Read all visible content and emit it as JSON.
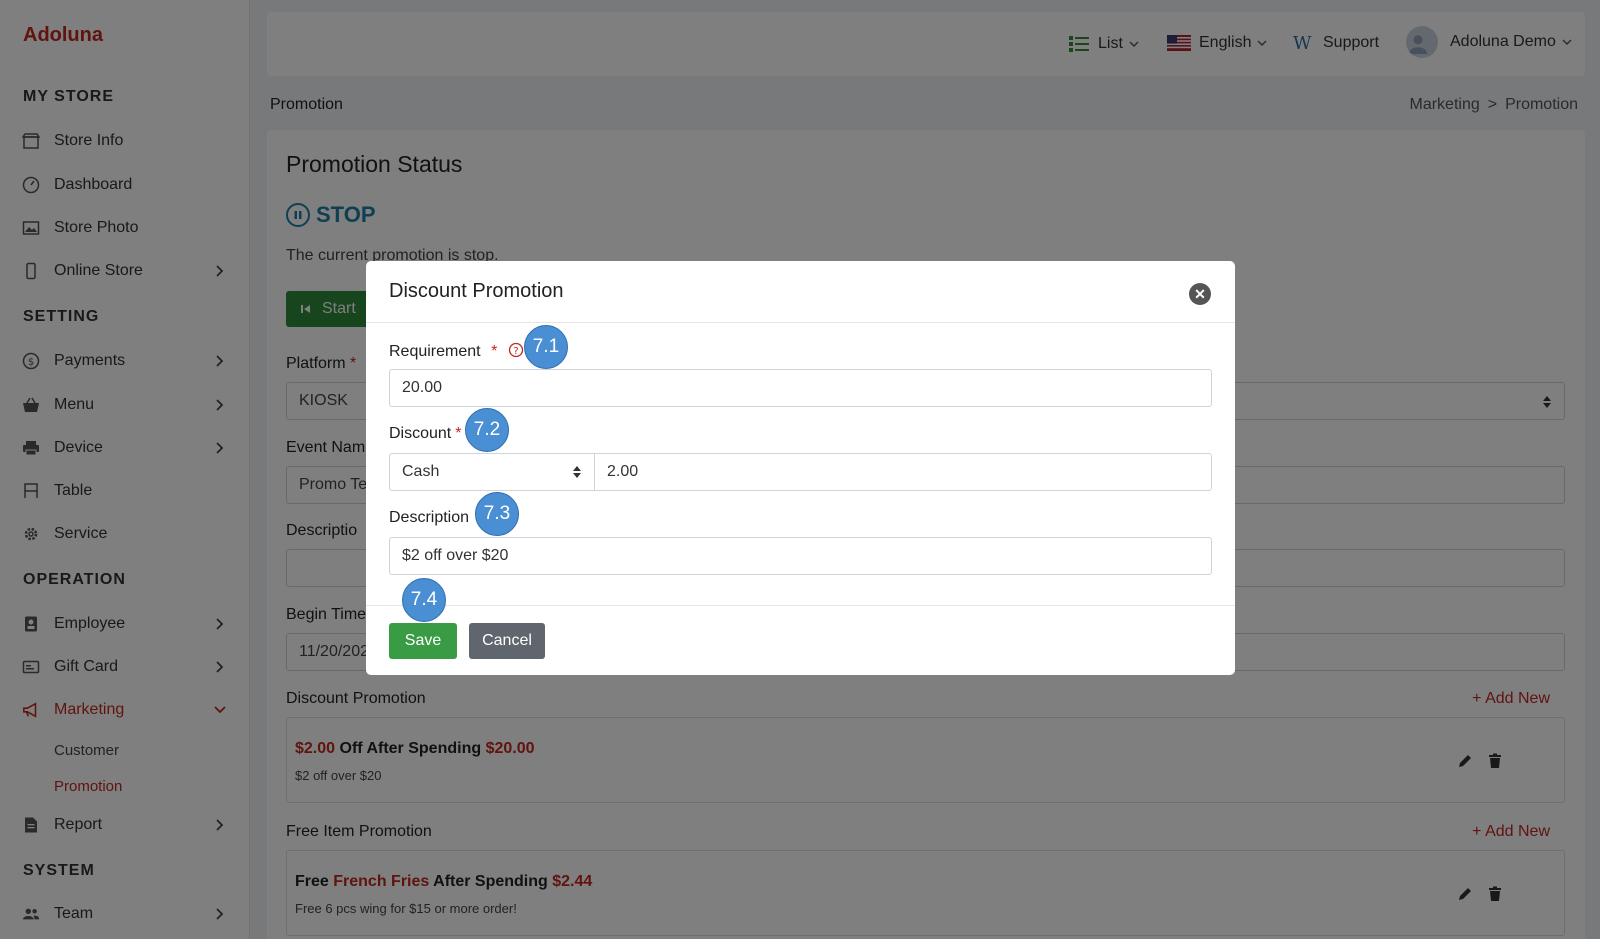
{
  "sidebar": {
    "brand": "Adoluna",
    "sections": {
      "my_store": "MY STORE",
      "setting": "SETTING",
      "operation": "OPERATION",
      "system": "SYSTEM"
    },
    "items": {
      "store_info": "Store Info",
      "dashboard": "Dashboard",
      "store_photo": "Store Photo",
      "online_store": "Online Store",
      "payments": "Payments",
      "menu": "Menu",
      "device": "Device",
      "table": "Table",
      "service": "Service",
      "employee": "Employee",
      "gift_card": "Gift Card",
      "marketing": "Marketing",
      "customer": "Customer",
      "promotion": "Promotion",
      "report": "Report",
      "team": "Team"
    }
  },
  "topbar": {
    "view": "List",
    "language": "English",
    "support": "Support",
    "user": "Adoluna Demo"
  },
  "page": {
    "title": "Promotion",
    "breadcrumb": [
      "Marketing",
      ">",
      "Promotion"
    ]
  },
  "main": {
    "status_heading": "Promotion Status",
    "status_value": "STOP",
    "status_text": "The current promotion is stop.",
    "start_label": "Start",
    "platform_label": "Platform",
    "platform_value": "KIOSK",
    "event_name_label": "Event Nam",
    "event_name_value": "Promo Te",
    "description_label": "Descriptio",
    "begin_time_label": "Begin Time",
    "begin_time_value": "11/20/202",
    "required_mark": "*",
    "discount_section": "Discount Promotion",
    "free_item_section": "Free Item Promotion",
    "add_new": "+ Add New",
    "discount_promo": {
      "amount": "$2.00",
      "mid": " Off After Spending ",
      "threshold": "$20.00",
      "desc": "$2 off over $20"
    },
    "free_promo": {
      "prefix": "Free ",
      "item": "French Fries",
      "mid": " After Spending ",
      "threshold": "$2.44",
      "desc": "Free 6 pcs wing for $15 or more order!"
    }
  },
  "modal": {
    "title": "Discount Promotion",
    "requirement_label": "Requirement",
    "requirement_value": "20.00",
    "discount_label": "Discount",
    "discount_type": "Cash",
    "discount_value": "2.00",
    "description_label": "Description",
    "description_value": "$2 off over $20",
    "save": "Save",
    "cancel": "Cancel",
    "required_mark": "*"
  },
  "badges": [
    "7.1",
    "7.2",
    "7.3",
    "7.4"
  ],
  "colors": {
    "brand": "#c0281f",
    "save": "#3a9b45",
    "cancel": "#5f666d",
    "badge": "#4a8fd4",
    "status": "#1e7fa6"
  }
}
